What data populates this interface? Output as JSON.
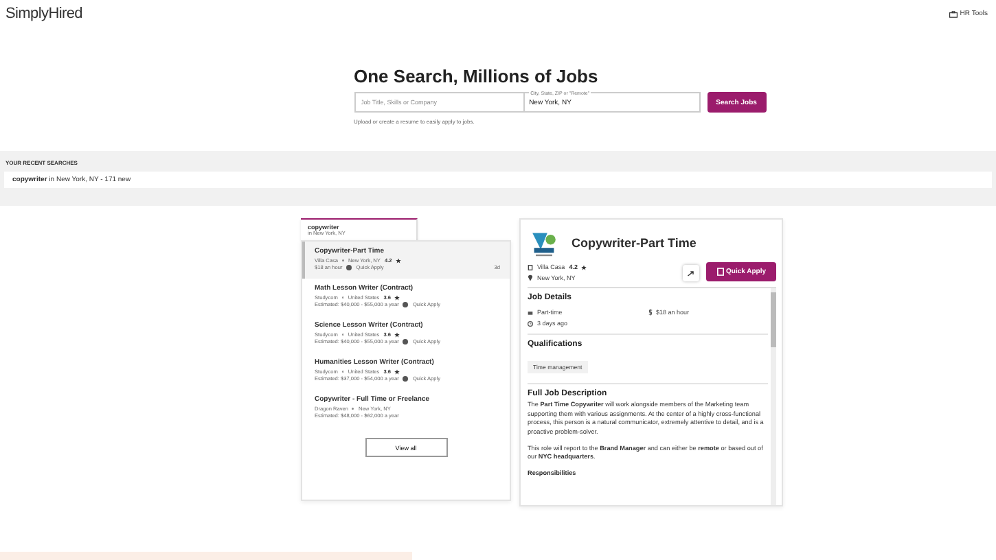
{
  "header": {
    "logo": "SimplyHired",
    "nav": [
      "HR Tools"
    ]
  },
  "hero": {
    "title": "One Search, Millions of Jobs",
    "job_field": {
      "placeholder": "Job Title, Skills or Company"
    },
    "location_field": {
      "label": "City, State, ZIP or \"Remote\"",
      "value": "New York, NY"
    },
    "button": "Search Jobs",
    "hint": "Upload or create a resume to easily apply to jobs."
  },
  "recent_searches": {
    "heading": "YOUR RECENT SEARCHES",
    "items": [
      {
        "query": "copywriter",
        "detail": "in New York, NY - 171 new"
      }
    ]
  },
  "results_tab": {
    "query": "copywriter",
    "location": "in New York, NY"
  },
  "jobs": [
    {
      "title": "Copywriter-Part Time",
      "company": "Villa Casa",
      "location": "New York, NY",
      "rating": "4.2",
      "pay": "$18 an hour",
      "quick_apply": "Quick Apply",
      "age": "3d",
      "selected": true
    },
    {
      "title": "Math Lesson Writer (Contract)",
      "company": "Studycom",
      "location": "United States",
      "rating": "3.6",
      "pay": "Estimated: $40,000 - $55,000 a year",
      "quick_apply": "Quick Apply",
      "selected": false
    },
    {
      "title": "Science Lesson Writer (Contract)",
      "company": "Studycom",
      "location": "United States",
      "rating": "3.6",
      "pay": "Estimated: $40,000 - $55,000 a year",
      "quick_apply": "Quick Apply",
      "selected": false
    },
    {
      "title": "Humanities Lesson Writer (Contract)",
      "company": "Studycom",
      "location": "United States",
      "rating": "3.6",
      "pay": "Estimated: $37,000 - $54,000 a year",
      "quick_apply": "Quick Apply",
      "selected": false
    },
    {
      "title": "Copywriter - Full Time or Freelance",
      "company": "Dragon Raven",
      "location": "New York, NY",
      "pay": "Estimated: $48,000 - $62,000 a year",
      "selected": false
    }
  ],
  "view_all": "View all",
  "detail": {
    "title": "Copywriter-Part Time",
    "company": "Villa Casa",
    "rating": "4.2",
    "location": "New York, NY",
    "apply": "Quick Apply",
    "job_details": {
      "heading": "Job Details",
      "type": "Part-time",
      "pay": "$18 an hour",
      "posted": "3 days ago"
    },
    "qualifications": {
      "heading": "Qualifications",
      "tags": [
        "Time management"
      ]
    },
    "description": {
      "heading": "Full Job Description",
      "paragraphs": [
        "The **Part Time Copywriter** will work alongside members of the Marketing team supporting them with various assignments. At the center of a highly cross-functional process, this person is a natural communicator, extremely attentive to detail, and is a proactive problem-solver.",
        "This role will report to the **Brand Manager** and can either be **remote** or based out of our **NYC headquarters**."
      ],
      "subheading": "Responsibilities"
    }
  }
}
